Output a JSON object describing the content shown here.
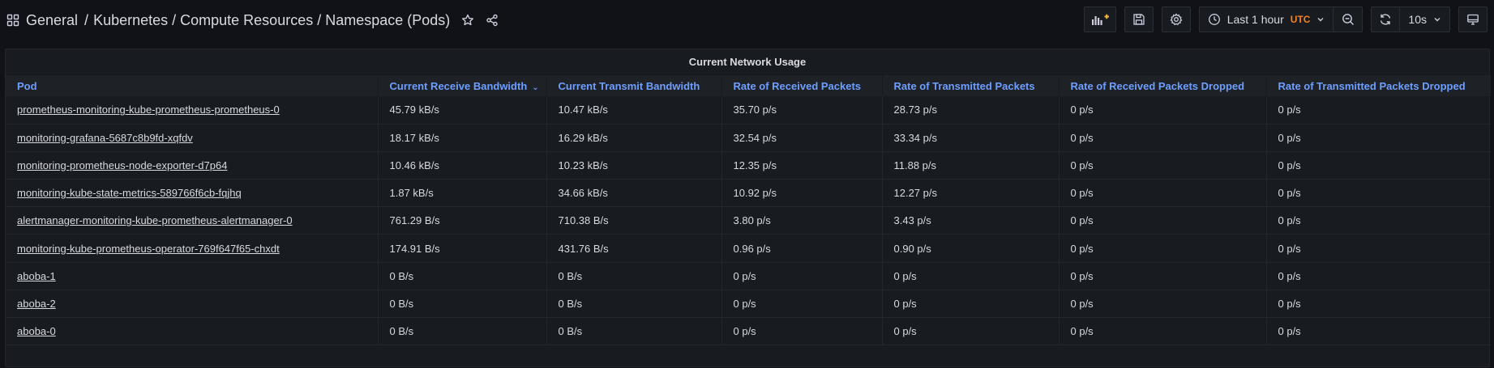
{
  "breadcrumb": {
    "folder": "General",
    "separator": "/",
    "dashboard": "Kubernetes / Compute Resources / Namespace (Pods)"
  },
  "toolbar": {
    "time_range": "Last 1 hour",
    "timezone": "UTC",
    "refresh_interval": "10s"
  },
  "panel": {
    "title": "Current Network Usage",
    "columns": [
      "Pod",
      "Current Receive Bandwidth",
      "Current Transmit Bandwidth",
      "Rate of Received Packets",
      "Rate of Transmitted Packets",
      "Rate of Received Packets Dropped",
      "Rate of Transmitted Packets Dropped"
    ],
    "rows": [
      [
        "prometheus-monitoring-kube-prometheus-prometheus-0",
        "45.79 kB/s",
        "10.47 kB/s",
        "35.70 p/s",
        "28.73 p/s",
        "0 p/s",
        "0 p/s"
      ],
      [
        "monitoring-grafana-5687c8b9fd-xqfdv",
        "18.17 kB/s",
        "16.29 kB/s",
        "32.54 p/s",
        "33.34 p/s",
        "0 p/s",
        "0 p/s"
      ],
      [
        "monitoring-prometheus-node-exporter-d7p64",
        "10.46 kB/s",
        "10.23 kB/s",
        "12.35 p/s",
        "11.88 p/s",
        "0 p/s",
        "0 p/s"
      ],
      [
        "monitoring-kube-state-metrics-589766f6cb-fqjhq",
        "1.87 kB/s",
        "34.66 kB/s",
        "10.92 p/s",
        "12.27 p/s",
        "0 p/s",
        "0 p/s"
      ],
      [
        "alertmanager-monitoring-kube-prometheus-alertmanager-0",
        "761.29 B/s",
        "710.38 B/s",
        "3.80 p/s",
        "3.43 p/s",
        "0 p/s",
        "0 p/s"
      ],
      [
        "monitoring-kube-prometheus-operator-769f647f65-chxdt",
        "174.91 B/s",
        "431.76 B/s",
        "0.96 p/s",
        "0.90 p/s",
        "0 p/s",
        "0 p/s"
      ],
      [
        "aboba-1",
        "0 B/s",
        "0 B/s",
        "0 p/s",
        "0 p/s",
        "0 p/s",
        "0 p/s"
      ],
      [
        "aboba-2",
        "0 B/s",
        "0 B/s",
        "0 p/s",
        "0 p/s",
        "0 p/s",
        "0 p/s"
      ],
      [
        "aboba-0",
        "0 B/s",
        "0 B/s",
        "0 p/s",
        "0 p/s",
        "0 p/s",
        "0 p/s"
      ]
    ]
  },
  "colors": {
    "background": "#111217",
    "panel": "#181b1f",
    "header_link": "#6e9fff",
    "timezone": "#f5821f",
    "add_panel_accent": "#f5b73b"
  },
  "icons": [
    "apps-icon",
    "star-icon",
    "share-icon",
    "add-panel-icon",
    "save-icon",
    "gear-icon",
    "clock-icon",
    "chevron-down-icon",
    "zoom-out-icon",
    "refresh-icon",
    "tv-icon",
    "sort-desc-icon"
  ]
}
